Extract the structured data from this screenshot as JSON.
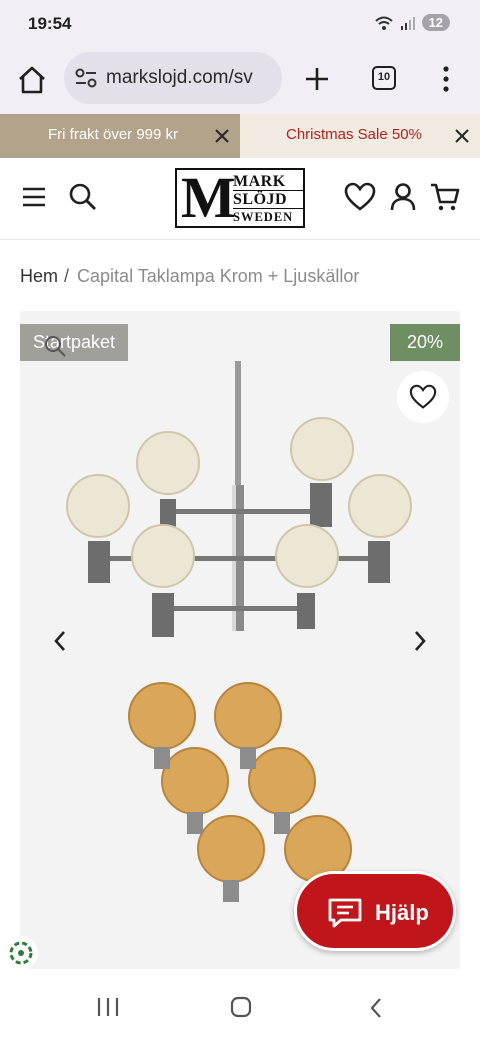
{
  "status": {
    "time": "19:54",
    "battery": "12"
  },
  "browser": {
    "url": "markslojd.com/sv",
    "tab_count": "10"
  },
  "promos": [
    {
      "text": "Fri frakt över 999 kr",
      "color": "#b3a38a"
    },
    {
      "text": "Christmas Sale 50%",
      "color": "#b3211e"
    }
  ],
  "header": {
    "logo": {
      "letter": "M",
      "line1": "MARK",
      "line2": "SLÖJD",
      "line3": "SWEDEN"
    }
  },
  "breadcrumb": {
    "home": "Hem",
    "separator": "/",
    "current": "Capital Taklampa Krom + Ljuskällor"
  },
  "product": {
    "badge_start": "Startpaket",
    "badge_discount": "20%",
    "icons": [
      "zoom-icon",
      "heart-icon",
      "chevron-left-icon",
      "chevron-right-icon"
    ]
  },
  "help": {
    "label": "Hjälp",
    "color": "#c0151b"
  }
}
